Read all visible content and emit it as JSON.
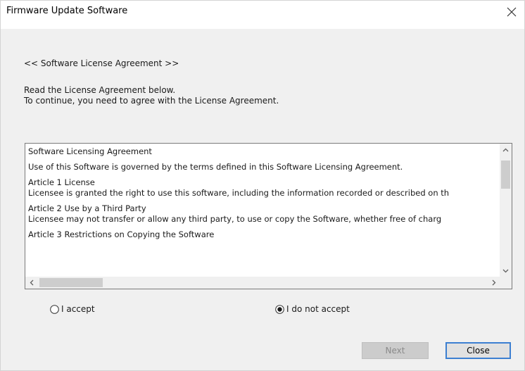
{
  "window": {
    "title": "Firmware Update Software",
    "close_glyph": "×"
  },
  "content": {
    "heading": "<< Software License Agreement >>",
    "intro_line1": "Read the License Agreement below.",
    "intro_line2": "To continue, you need to agree with the License Agreement."
  },
  "license": {
    "title": "Software Licensing Agreement",
    "para1": "Use of this Software is governed by the terms defined in this Software Licensing Agreement.",
    "article1_title": "Article 1 License",
    "article1_text": "Licensee is granted the right to use this software, including the information recorded or described on th",
    "article2_title": "Article 2 Use by a Third Party",
    "article2_text": "Licensee may not transfer or allow any third party, to use or copy the Software, whether free of charg",
    "article3_title": "Article 3 Restrictions on Copying the Software"
  },
  "options": {
    "accept_label": "I accept",
    "decline_label": "I do not accept",
    "selected": "decline"
  },
  "buttons": {
    "next_label": "Next",
    "close_label": "Close",
    "next_enabled": false
  },
  "colors": {
    "client_bg": "#f0f0f0",
    "focus_border": "#3c7fd1",
    "disabled_text": "#8a8a8a"
  }
}
